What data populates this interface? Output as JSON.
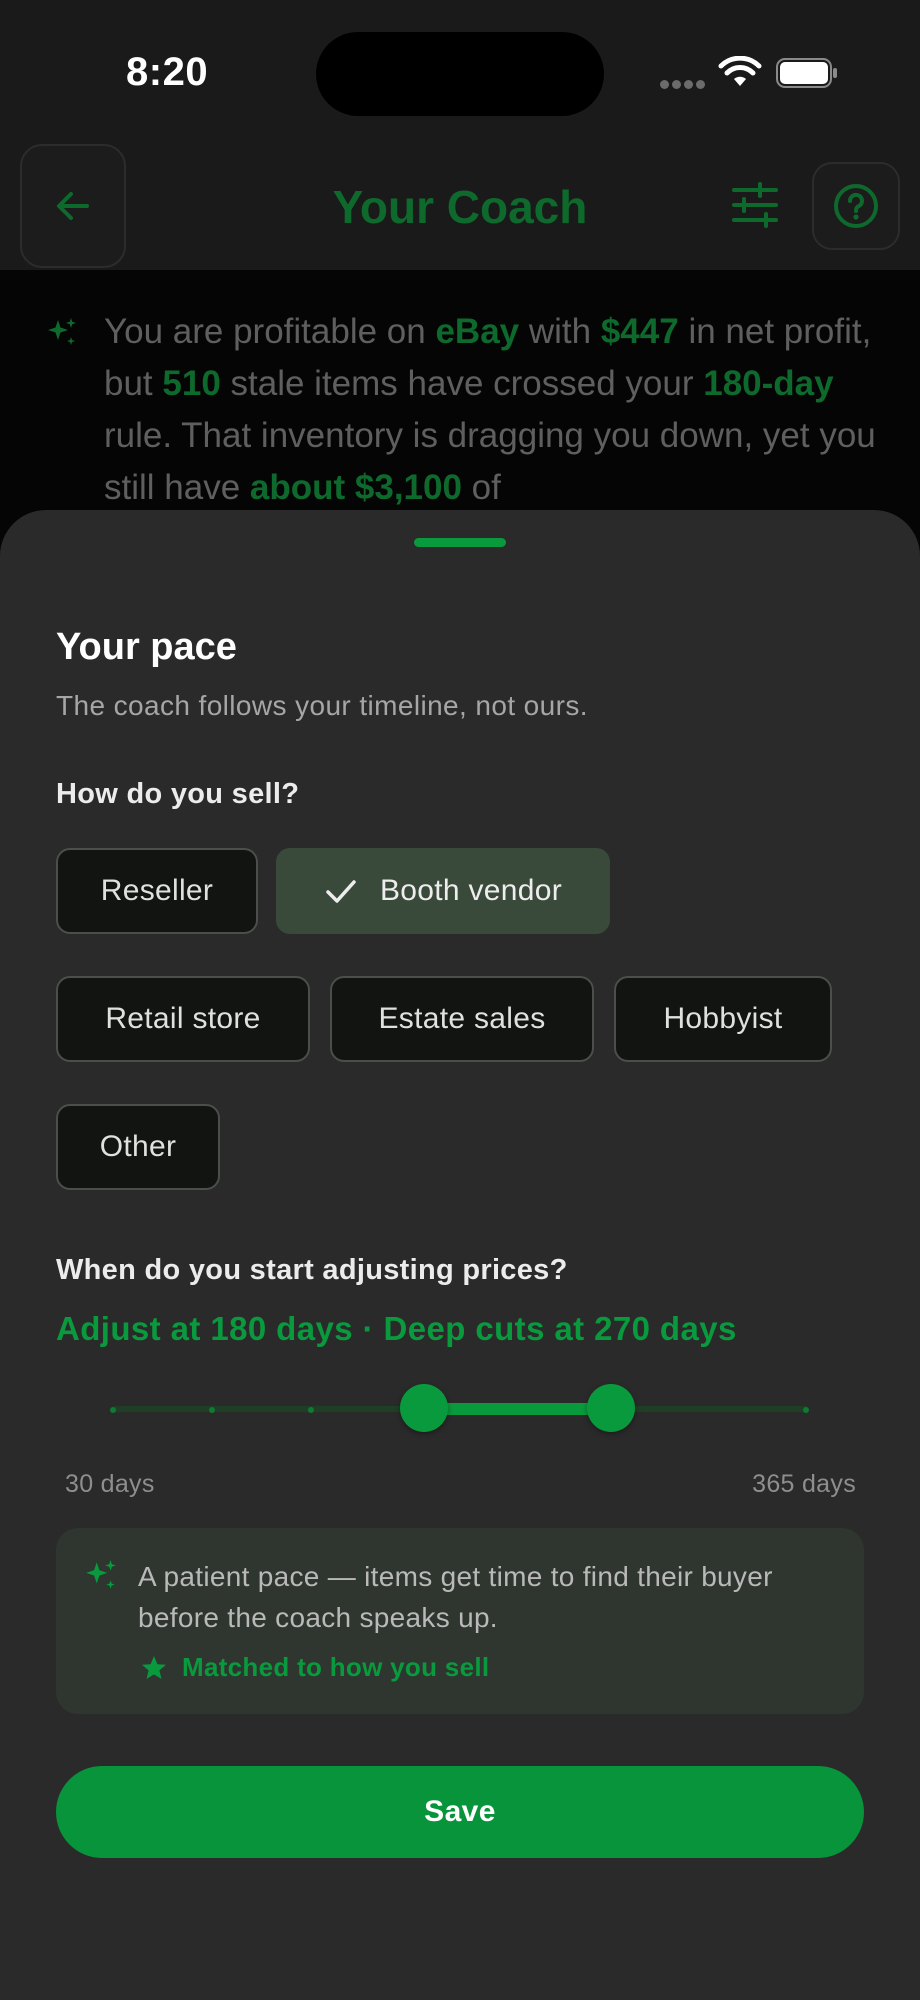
{
  "status_bar": {
    "time": "8:20"
  },
  "header": {
    "title": "Your Coach"
  },
  "summary": {
    "segments": [
      {
        "text": "You are profitable on ",
        "hl": false
      },
      {
        "text": "eBay",
        "hl": true
      },
      {
        "text": " with ",
        "hl": false
      },
      {
        "text": "$447",
        "hl": true
      },
      {
        "text": " in net profit, but ",
        "hl": false
      },
      {
        "text": "510",
        "hl": true
      },
      {
        "text": " stale items have crossed your ",
        "hl": false
      },
      {
        "text": "180-day",
        "hl": true
      },
      {
        "text": " rule. That inventory is dragging you down, yet you still have ",
        "hl": false
      },
      {
        "text": "about $3,100",
        "hl": true
      },
      {
        "text": " of",
        "hl": false
      }
    ]
  },
  "sheet": {
    "title": "Your pace",
    "subtitle": "The coach follows your timeline, not ours.",
    "sell_question": "How do you sell?",
    "options": [
      "Reseller",
      "Booth vendor",
      "Retail store",
      "Estate sales",
      "Hobbyist",
      "Other"
    ],
    "selected_option": "Booth vendor",
    "price_question": "When do you start adjusting prices?",
    "threshold_text": "Adjust at 180 days · Deep cuts at 270 days",
    "slider": {
      "min": 30,
      "max": 365,
      "adjust_days": 180,
      "deep_cut_days": 270,
      "min_label": "30 days",
      "max_label": "365 days"
    },
    "info_text": "A patient pace — items get time to find their buyer before the coach speaks up.",
    "matched_label": "Matched to how you sell",
    "save_label": "Save"
  },
  "colors": {
    "accent": "#0a9a3e",
    "dim_accent": "#0e6a2c",
    "sheet_bg": "#2a2a2a",
    "chip_selected": "#3a4a3a"
  },
  "icons": [
    "back-arrow-icon",
    "sliders-icon",
    "help-icon",
    "sparkle-icon",
    "check-icon",
    "star-icon",
    "wifi-icon",
    "battery-icon"
  ]
}
